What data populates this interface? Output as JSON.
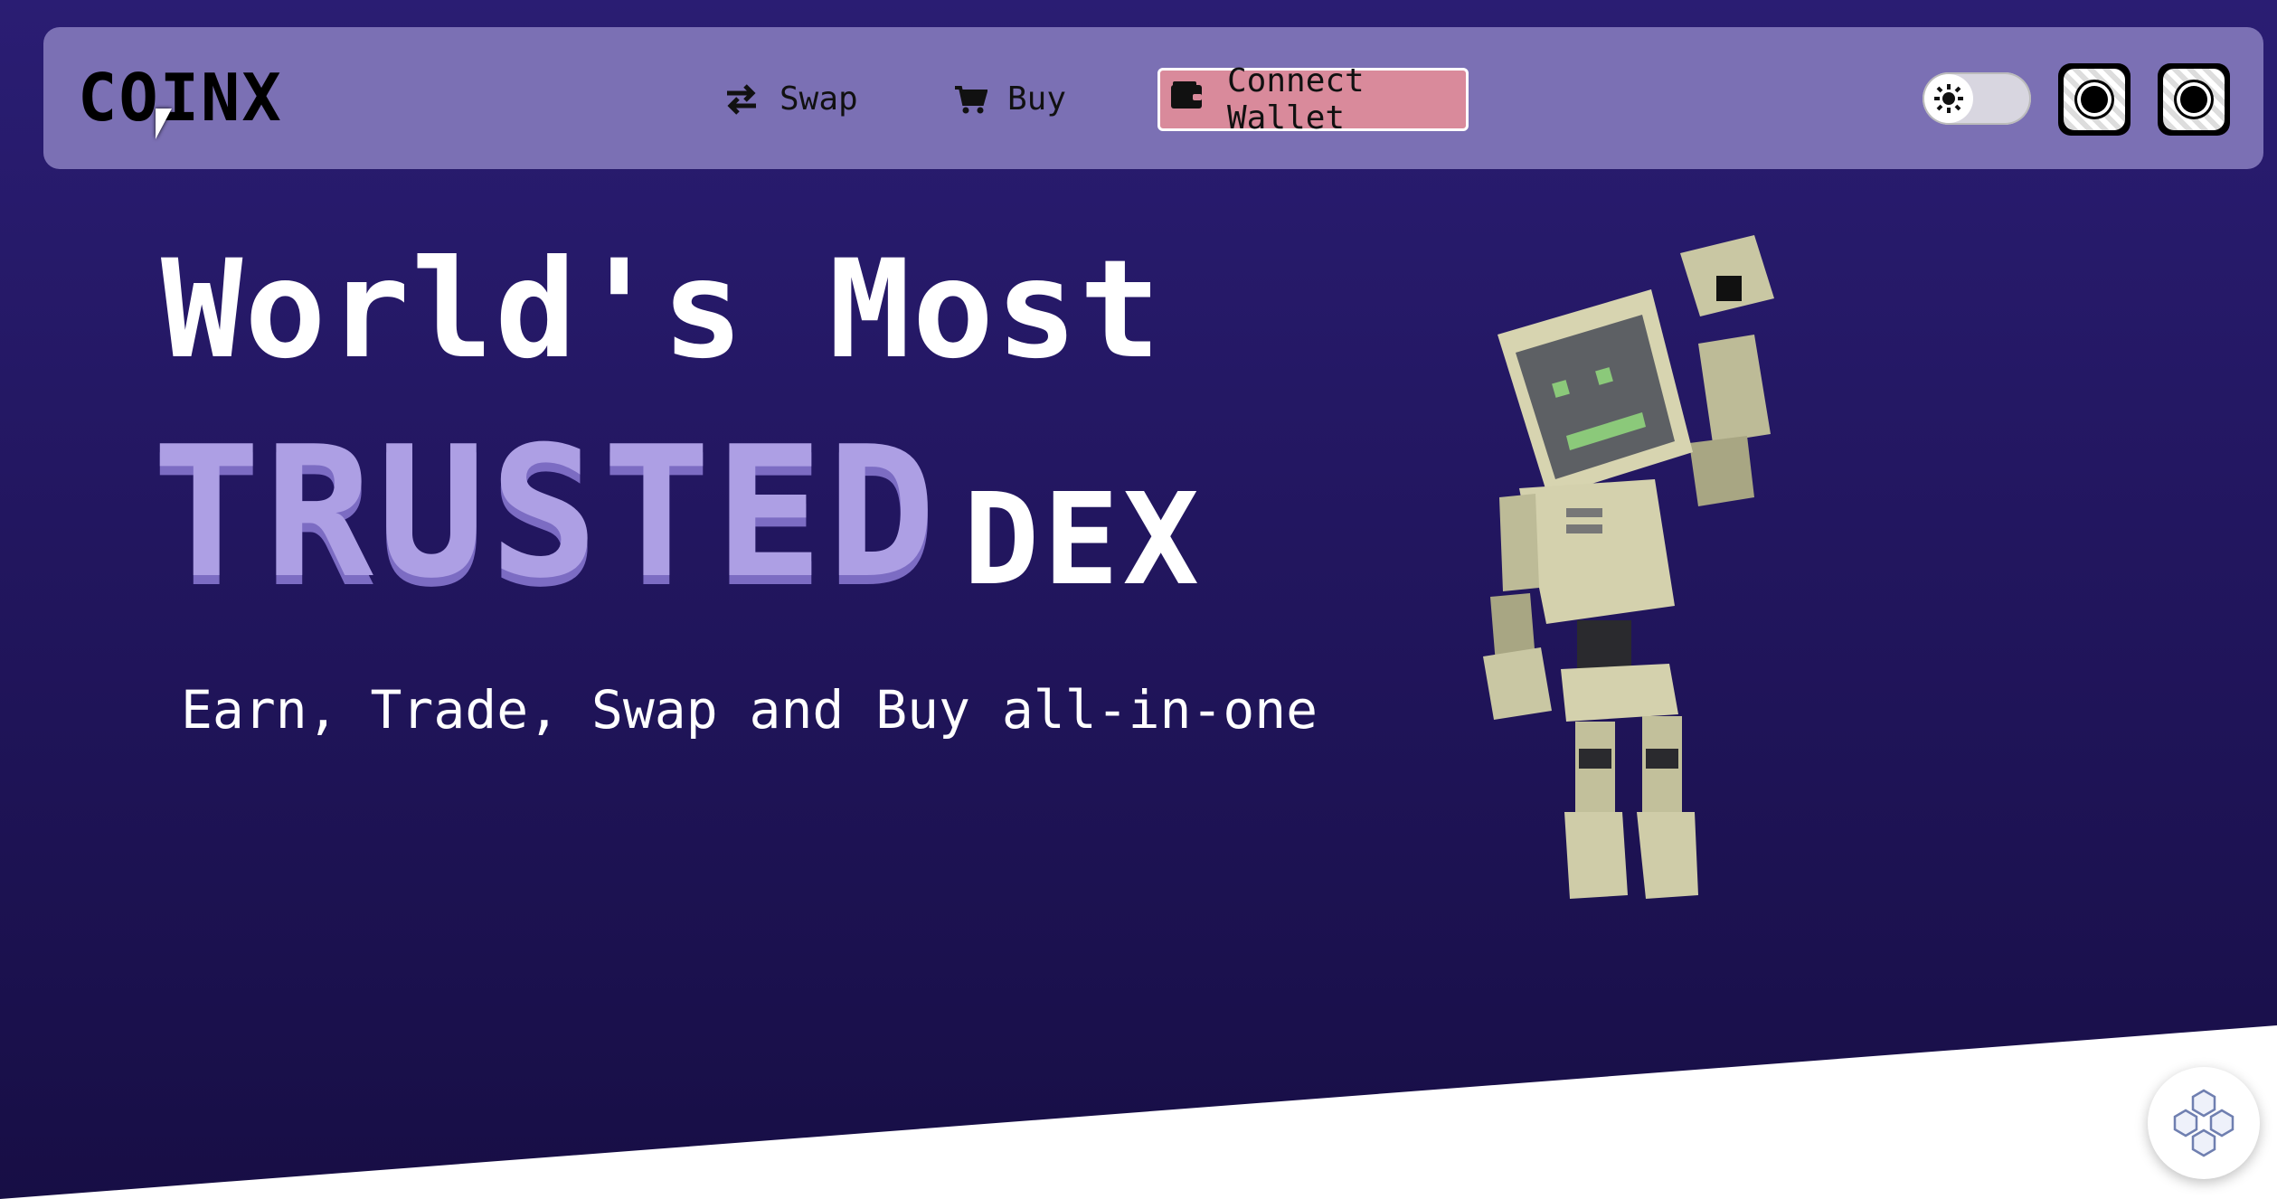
{
  "header": {
    "logo": "COINX",
    "nav": [
      {
        "label": "Swap",
        "icon": "swap-arrows-icon"
      },
      {
        "label": "Buy",
        "icon": "cart-icon"
      }
    ],
    "connect_wallet": {
      "label": "Connect Wallet",
      "icon": "wallet-icon"
    },
    "theme_toggle": {
      "icon": "sun-icon"
    },
    "social_buttons": [
      {
        "icon": "social-icon"
      },
      {
        "icon": "social-icon"
      }
    ]
  },
  "hero": {
    "line1": "World's Most",
    "highlight": "TRUSTED",
    "suffix": "DEX",
    "subtitle": "Earn, Trade, Swap and Buy all-in-one"
  },
  "fab": {
    "icon": "blocks-logo-icon"
  },
  "colors": {
    "background": "#22165f",
    "navbar": "#7b70b4",
    "highlight": "#ad9fe4",
    "connect_button": "#d98a9b"
  }
}
